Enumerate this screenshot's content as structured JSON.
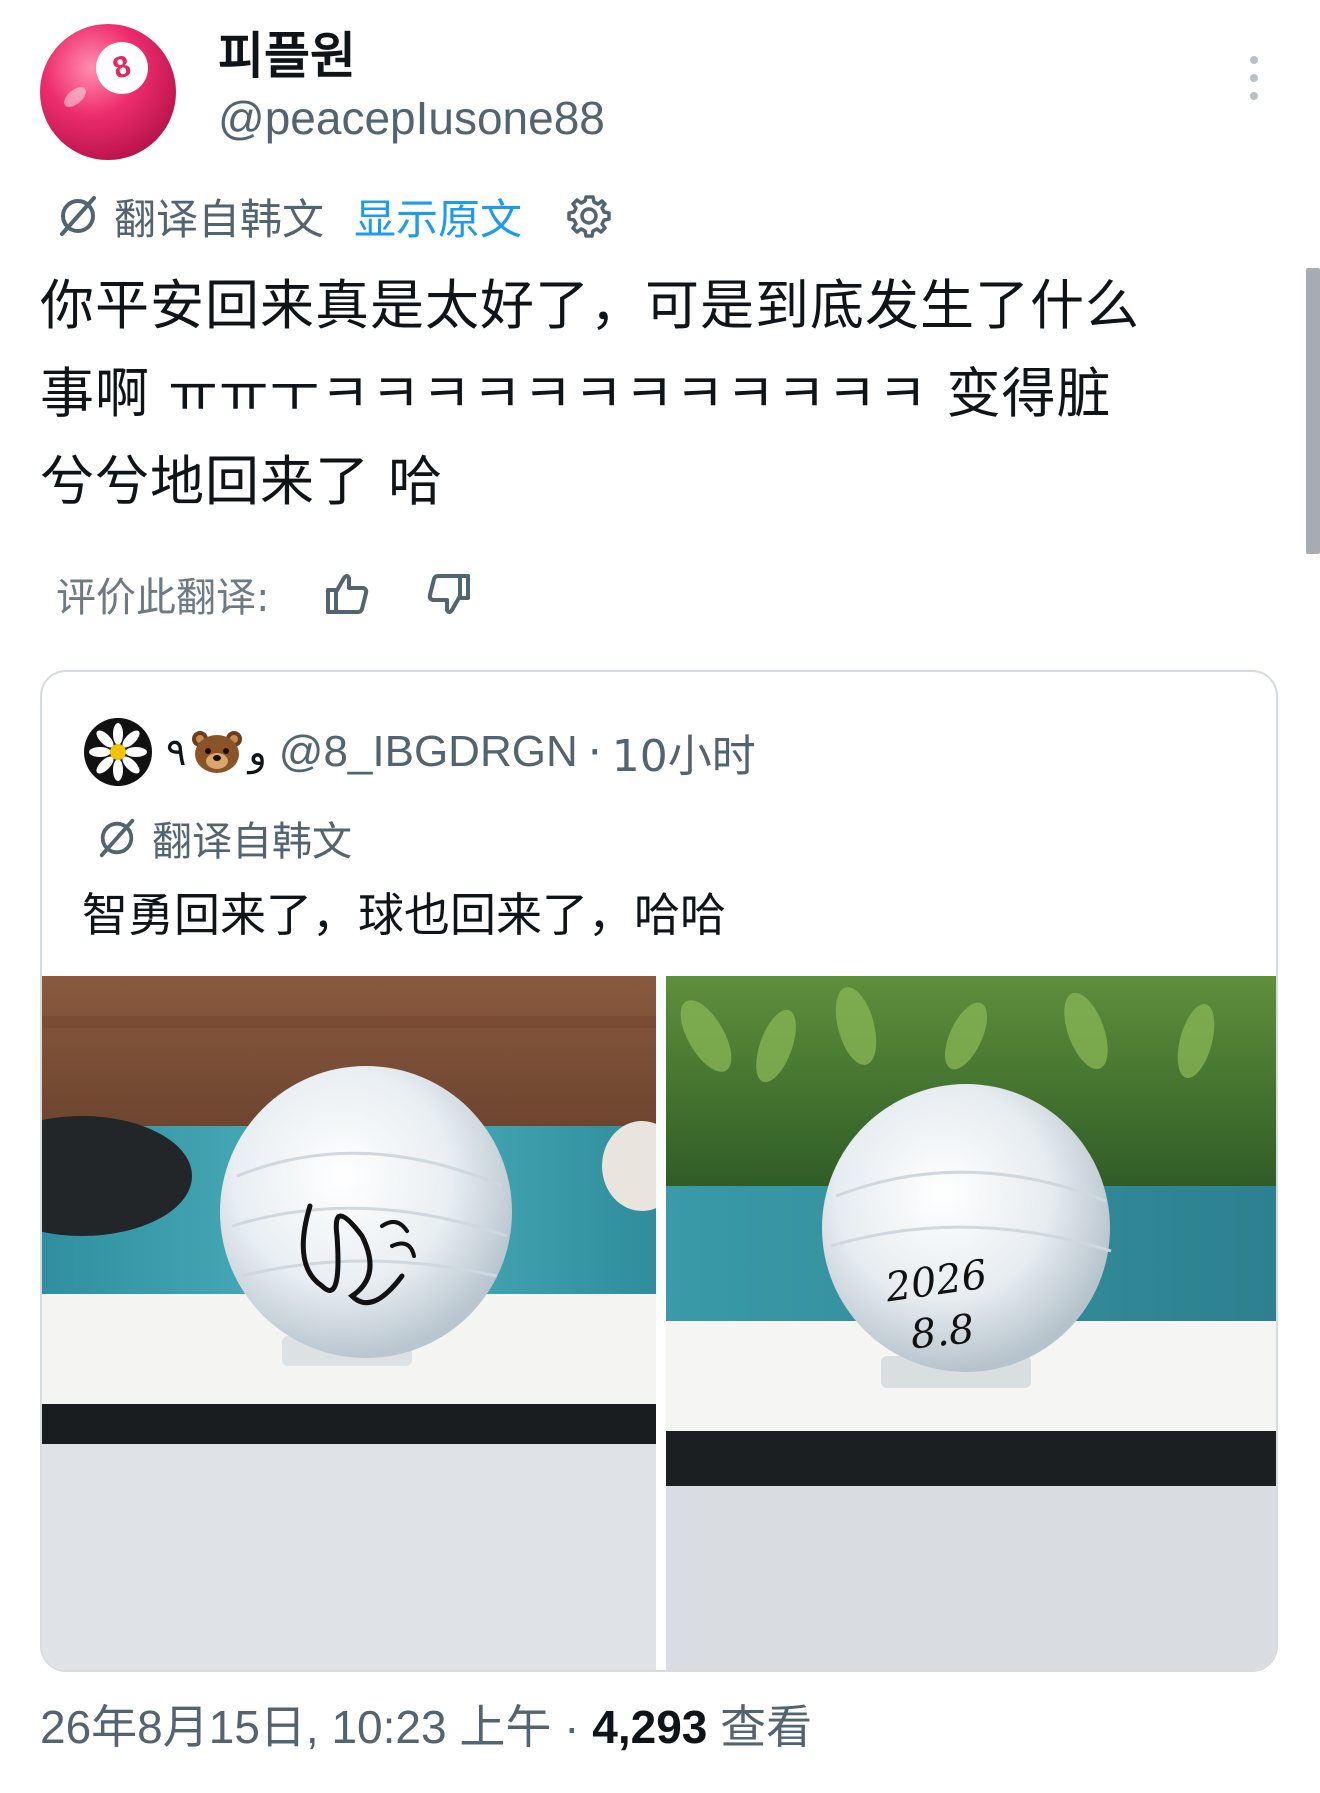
{
  "header": {
    "display_name": "피플원",
    "handle": "@peacepIusone88",
    "avatar_number": "8",
    "more_icon": "more-vertical-icon"
  },
  "translation": {
    "label": "翻译自韩文",
    "show_original": "显示原文",
    "settings_icon": "gear-icon"
  },
  "tweet": {
    "line1": "你平安回来真是太好了，可是到底发生了什么",
    "line2": "事啊 ㅠㅠㅜㅋㅋㅋㅋㅋㅋㅋㅋㅋㅋㅋㅋ 变得脏",
    "line3": "兮兮地回来了 哈"
  },
  "rating": {
    "label": "评价此翻译:",
    "up_icon": "thumbs-up-icon",
    "down_icon": "thumbs-down-icon"
  },
  "quote": {
    "author_name": "٩",
    "author_name_tail": "و",
    "handle": "@8_IBGDRGN",
    "separator": "·",
    "time": "10小时",
    "translation_label": "翻译自韩文",
    "text": "智勇回来了，球也回来了，哈哈",
    "photos": [
      {
        "name": "signed-ball-photo-left",
        "signature_text": "signature"
      },
      {
        "name": "signed-ball-photo-right",
        "signature_text": "2026 8.8"
      }
    ]
  },
  "footer": {
    "date": "26年8月15日, 10:23 上午",
    "separator": "·",
    "views_count": "4,293",
    "views_label": "查看"
  },
  "colors": {
    "link": "#1d9bf0",
    "muted": "#536471",
    "text": "#0f1419",
    "border": "#d6dbdf"
  }
}
